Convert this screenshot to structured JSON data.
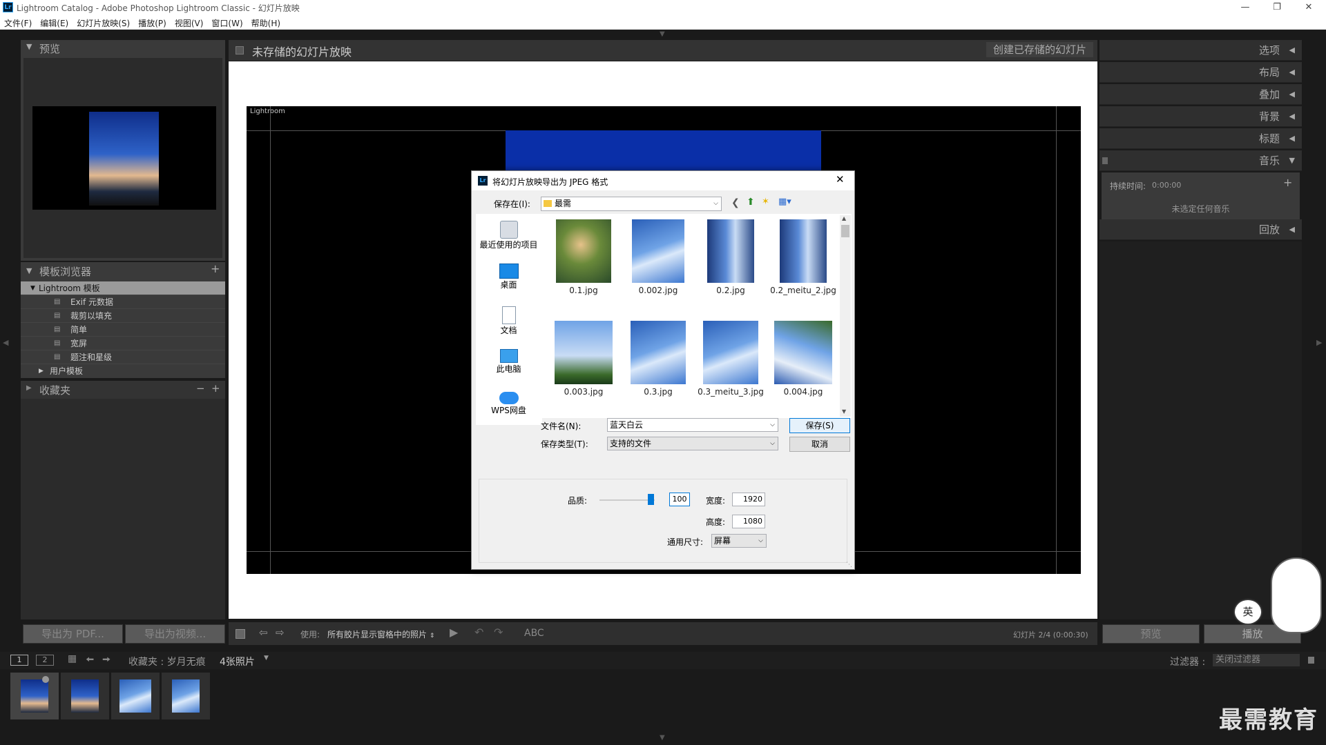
{
  "window": {
    "title": "Lightroom Catalog - Adobe Photoshop Lightroom Classic - 幻灯片放映",
    "logo": "Lr"
  },
  "menu": [
    "文件(F)",
    "编辑(E)",
    "幻灯片放映(S)",
    "播放(P)",
    "视图(V)",
    "窗口(W)",
    "帮助(H)"
  ],
  "left_panel": {
    "preview_title": "预览",
    "template_browser_title": "模板浏览器",
    "lightroom_templates": "Lightroom 模板",
    "templates": [
      "Exif 元数据",
      "裁剪以填充",
      "简单",
      "宽屏",
      "题注和星级"
    ],
    "user_templates": "用户模板",
    "collections_title": "收藏夹",
    "export_pdf": "导出为 PDF...",
    "export_video": "导出为视频..."
  },
  "center": {
    "slideshow_title": "未存储的幻灯片放映",
    "create_saved": "创建已存储的幻灯片",
    "identity_plate": "Lightroom"
  },
  "toolbar": {
    "use_label": "使用:",
    "use_value": "所有胶片显示窗格中的照片",
    "abc": "ABC",
    "slide_info": "幻灯片 2/4 (0:00:30)"
  },
  "right_panel": {
    "rows": [
      "选项",
      "布局",
      "叠加",
      "背景",
      "标题",
      "音乐",
      "回放"
    ],
    "duration_label": "持续时间:",
    "duration_value": "0:00:00",
    "no_music": "未选定任何音乐",
    "preview_btn": "预览",
    "play_btn": "播放"
  },
  "filmstrip_bar": {
    "page1": "1",
    "page2": "2",
    "source": "收藏夹 : 岁月无痕",
    "count": "4张照片",
    "filter_label": "过滤器 :",
    "filter_value": "关闭过滤器"
  },
  "dialog": {
    "title": "将幻灯片放映导出为 JPEG 格式",
    "save_in_label": "保存在(I):",
    "save_in_value": "最需",
    "nav": [
      "最近使用的项目",
      "桌面",
      "文档",
      "此电脑",
      "WPS网盘"
    ],
    "files": [
      "0.1.jpg",
      "0.002.jpg",
      "0.2.jpg",
      "0.2_meitu_2.jpg",
      "0.003.jpg",
      "0.3.jpg",
      "0.3_meitu_3.jpg",
      "0.004.jpg"
    ],
    "filename_label": "文件名(N):",
    "filename_value": "蓝天白云",
    "filetype_label": "保存类型(T):",
    "filetype_value": "支持的文件",
    "save_btn": "保存(S)",
    "cancel_btn": "取消",
    "quality_label": "品质:",
    "quality_value": "100",
    "width_label": "宽度:",
    "width_value": "1920",
    "height_label": "高度:",
    "height_value": "1080",
    "common_size_label": "通用尺寸:",
    "common_size_value": "屏幕"
  },
  "ime_badge": "英",
  "watermark": "最需教育"
}
